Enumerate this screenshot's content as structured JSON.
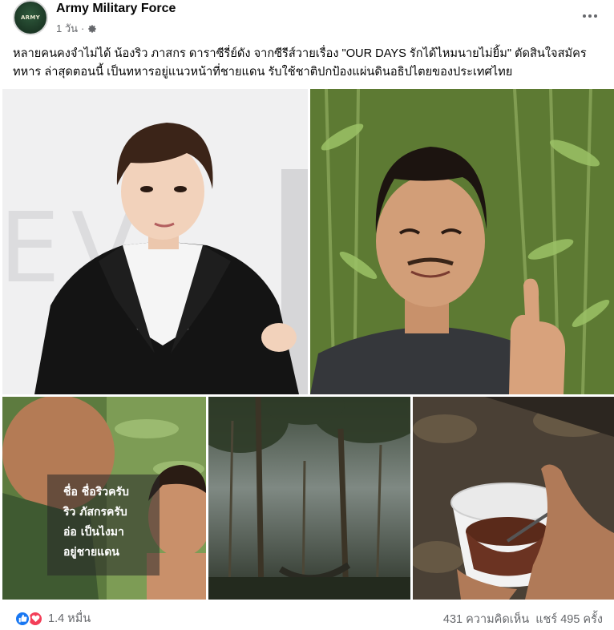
{
  "post": {
    "page_name": "Army Military Force",
    "time": "1 วัน",
    "separator": "·",
    "avatar_text": "ARMY",
    "privacy_icon": "gear-icon",
    "more_icon": "more-dots-icon",
    "caption": "หลายคนคงจำไม่ได้ น้องริว ภาสกร ดาราซีรี่ย์ดัง จากซีรีส์วายเรื่อง \"OUR DAYS รักได้ไหมนายไม่ยิ้ม\" ตัดสินใจสมัครทหาร ล่าสุดตอนนี้ เป็นทหารอยู่แนวหน้าที่ชายแดน รับใช้ชาติปกป้องแผ่นดินอธิปไตยของประเทศไทย"
  },
  "photos": {
    "subtitle_lines": [
      "ชื่อ ชื่อริวครับ",
      "ริว ภัสกรครับ",
      "อ่อ เป็นไงมา",
      "อยู่ชายแดน"
    ]
  },
  "footer": {
    "reaction_icons": [
      "like-icon",
      "love-icon"
    ],
    "reaction_count": "1.4 หมื่น",
    "comments": "431 ความคิดเห็น",
    "shares": "แชร์ 495 ครั้ง"
  },
  "colors": {
    "like": "#1877f2",
    "love": "#f33e58",
    "secondary_text": "#65676b"
  }
}
